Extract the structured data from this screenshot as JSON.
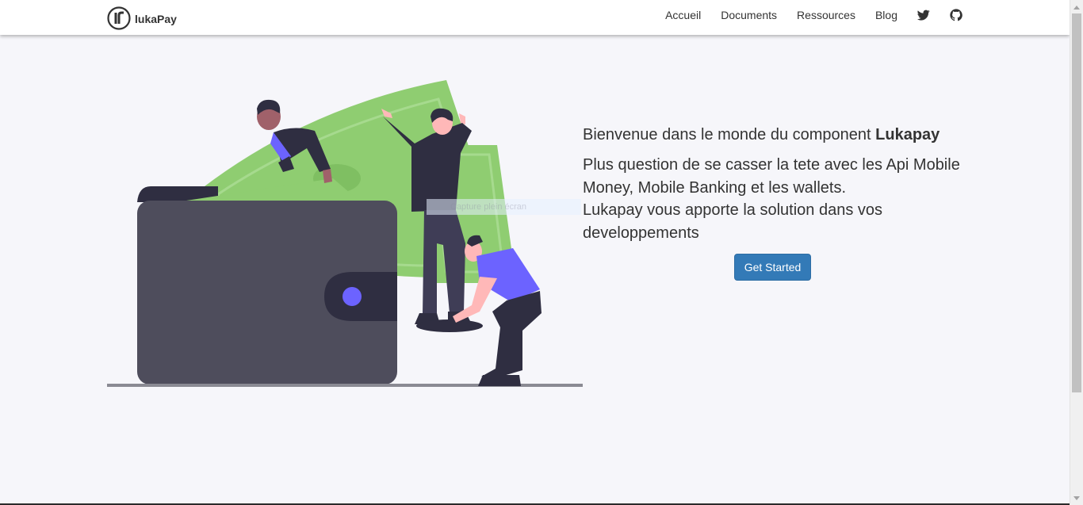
{
  "navbar": {
    "brand": "lukaPay",
    "links": [
      "Accueil",
      "Documents",
      "Ressources",
      "Blog"
    ],
    "icons": [
      "twitter-icon",
      "github-icon"
    ]
  },
  "hero": {
    "welcome_prefix": "Bienvenue dans le monde du component ",
    "welcome_brand": "Lukapay",
    "desc_line1": "Plus question de se casser la tete avec les Api Mobile Money, Mobile Banking et les wallets.",
    "desc_line2": "Lukapay vous apporte la solution dans vos developpements",
    "cta": "Get Started",
    "overlay_text": "Capture plein écran"
  },
  "colors": {
    "background": "#f6f6fa",
    "primary_button": "#337ab7",
    "text": "#333333",
    "wallet": "#4e4d5c",
    "money": "#8fd17a",
    "accent": "#6c63ff"
  }
}
